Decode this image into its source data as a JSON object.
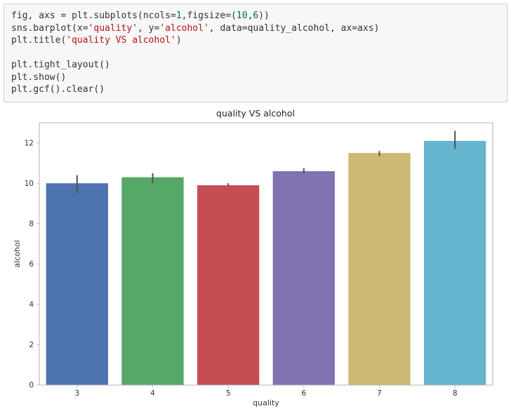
{
  "code": {
    "lines": [
      [
        {
          "t": "fig, axs = plt.subplots(ncols=",
          "c": ""
        },
        {
          "t": "1",
          "c": "tok-num"
        },
        {
          "t": ",figsize=(",
          "c": ""
        },
        {
          "t": "10",
          "c": "tok-num"
        },
        {
          "t": ",",
          "c": ""
        },
        {
          "t": "6",
          "c": "tok-num"
        },
        {
          "t": "))",
          "c": ""
        }
      ],
      [
        {
          "t": "sns.barplot(x=",
          "c": ""
        },
        {
          "t": "'quality'",
          "c": "tok-str"
        },
        {
          "t": ", y=",
          "c": ""
        },
        {
          "t": "'alcohol'",
          "c": "tok-str"
        },
        {
          "t": ", data=quality_alcohol, ax=axs)",
          "c": ""
        }
      ],
      [
        {
          "t": "plt.title(",
          "c": ""
        },
        {
          "t": "'quality VS alcohol'",
          "c": "tok-str"
        },
        {
          "t": ")",
          "c": ""
        }
      ],
      [
        {
          "t": "",
          "c": ""
        }
      ],
      [
        {
          "t": "plt.tight_layout()",
          "c": ""
        }
      ],
      [
        {
          "t": "plt.show()",
          "c": ""
        }
      ],
      [
        {
          "t": "plt.gcf().clear()",
          "c": ""
        }
      ]
    ]
  },
  "chart_data": {
    "type": "bar",
    "title": "quality VS alcohol",
    "xlabel": "quality",
    "ylabel": "alcohol",
    "ylim": [
      0,
      13
    ],
    "yticks": [
      0,
      2,
      4,
      6,
      8,
      10,
      12
    ],
    "categories": [
      "3",
      "4",
      "5",
      "6",
      "7",
      "8"
    ],
    "values": [
      10.0,
      10.3,
      9.9,
      10.6,
      11.5,
      12.1
    ],
    "errors": [
      {
        "lo": 9.5,
        "hi": 10.4
      },
      {
        "lo": 10.0,
        "hi": 10.5
      },
      {
        "lo": 9.85,
        "hi": 10.0
      },
      {
        "lo": 10.5,
        "hi": 10.75
      },
      {
        "lo": 11.35,
        "hi": 11.6
      },
      {
        "lo": 11.7,
        "hi": 12.6
      }
    ],
    "colors": [
      "#4c72b0",
      "#55a868",
      "#c44e52",
      "#8172b2",
      "#ccb974",
      "#64b5cd"
    ]
  }
}
